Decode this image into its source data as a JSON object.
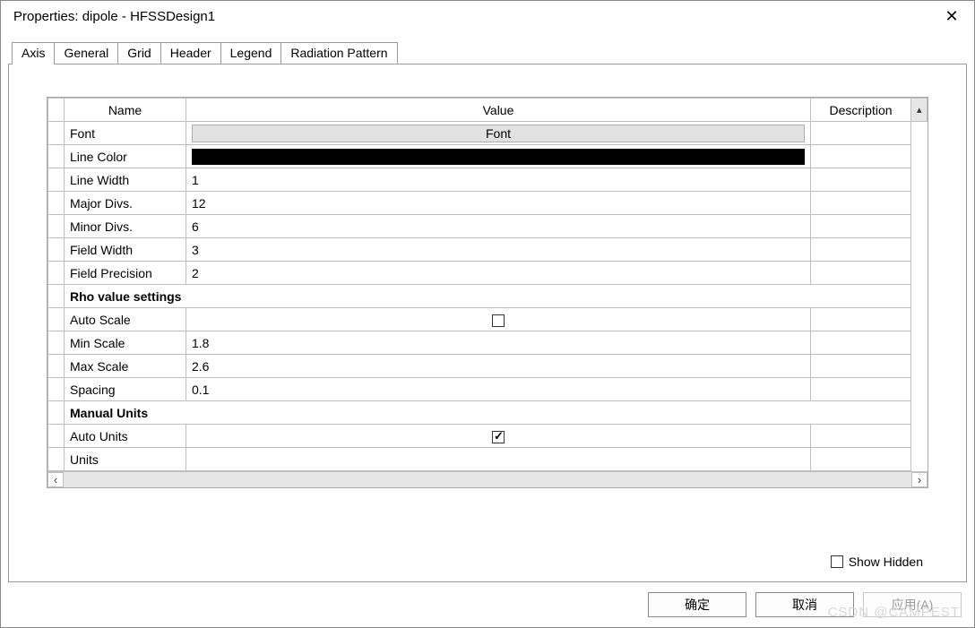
{
  "titlebar": {
    "title": "Properties: dipole - HFSSDesign1",
    "close": "✕"
  },
  "tabs": {
    "items": [
      {
        "label": "Axis"
      },
      {
        "label": "General"
      },
      {
        "label": "Grid"
      },
      {
        "label": "Header"
      },
      {
        "label": "Legend"
      },
      {
        "label": "Radiation Pattern"
      }
    ],
    "active": 0
  },
  "grid": {
    "headers": {
      "name": "Name",
      "value": "Value",
      "description": "Description"
    },
    "rows": [
      {
        "type": "font",
        "name": "Font",
        "value": "Font"
      },
      {
        "type": "color",
        "name": "Line Color",
        "color": "#000000"
      },
      {
        "type": "text",
        "name": "Line Width",
        "value": "1"
      },
      {
        "type": "text",
        "name": "Major Divs.",
        "value": "12"
      },
      {
        "type": "text",
        "name": "Minor Divs.",
        "value": "6"
      },
      {
        "type": "text",
        "name": "Field Width",
        "value": "3"
      },
      {
        "type": "text",
        "name": "Field Precision",
        "value": "2"
      },
      {
        "type": "section",
        "name": "Rho value settings"
      },
      {
        "type": "check",
        "name": "Auto Scale",
        "checked": false
      },
      {
        "type": "text",
        "name": "Min Scale",
        "value": "1.8"
      },
      {
        "type": "text",
        "name": "Max Scale",
        "value": "2.6"
      },
      {
        "type": "text",
        "name": "Spacing",
        "value": "0.1"
      },
      {
        "type": "section",
        "name": "Manual Units"
      },
      {
        "type": "check",
        "name": "Auto Units",
        "checked": true
      },
      {
        "type": "text",
        "name": "Units",
        "value": ""
      }
    ]
  },
  "show_hidden": {
    "label": "Show Hidden",
    "checked": false
  },
  "buttons": {
    "ok": "确定",
    "cancel": "取消",
    "apply": "应用(A)"
  },
  "watermark": "CSDN @CAMPEST"
}
